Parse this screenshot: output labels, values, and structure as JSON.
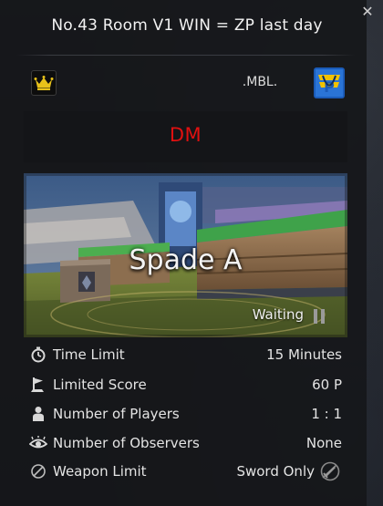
{
  "room": {
    "title": "No.43 Room V1 WIN = ZP last day",
    "clan_name": ".MBL.",
    "mode": "DM",
    "map_name": "Spade A",
    "status": "Waiting"
  },
  "icons": {
    "close": "close-icon",
    "host": "crown-icon",
    "clan": "clan-emblem-icon",
    "pause": "pause-icon"
  },
  "info": [
    {
      "label": "Time Limit",
      "value": "15 Minutes",
      "icon": "stopwatch-icon"
    },
    {
      "label": "Limited Score",
      "value": "60 P",
      "icon": "flag-icon"
    },
    {
      "label": "Number of Players",
      "value": "1 : 1",
      "icon": "player-icon"
    },
    {
      "label": "Number of Observers",
      "value": "None",
      "icon": "eye-icon"
    },
    {
      "label": "Weapon Limit",
      "value": "Sword Only",
      "icon": "no-entry-icon"
    }
  ],
  "colors": {
    "mode": "#e01010",
    "crown": "#e8c21a",
    "clan_badge_bg": "#1b5bb8"
  }
}
